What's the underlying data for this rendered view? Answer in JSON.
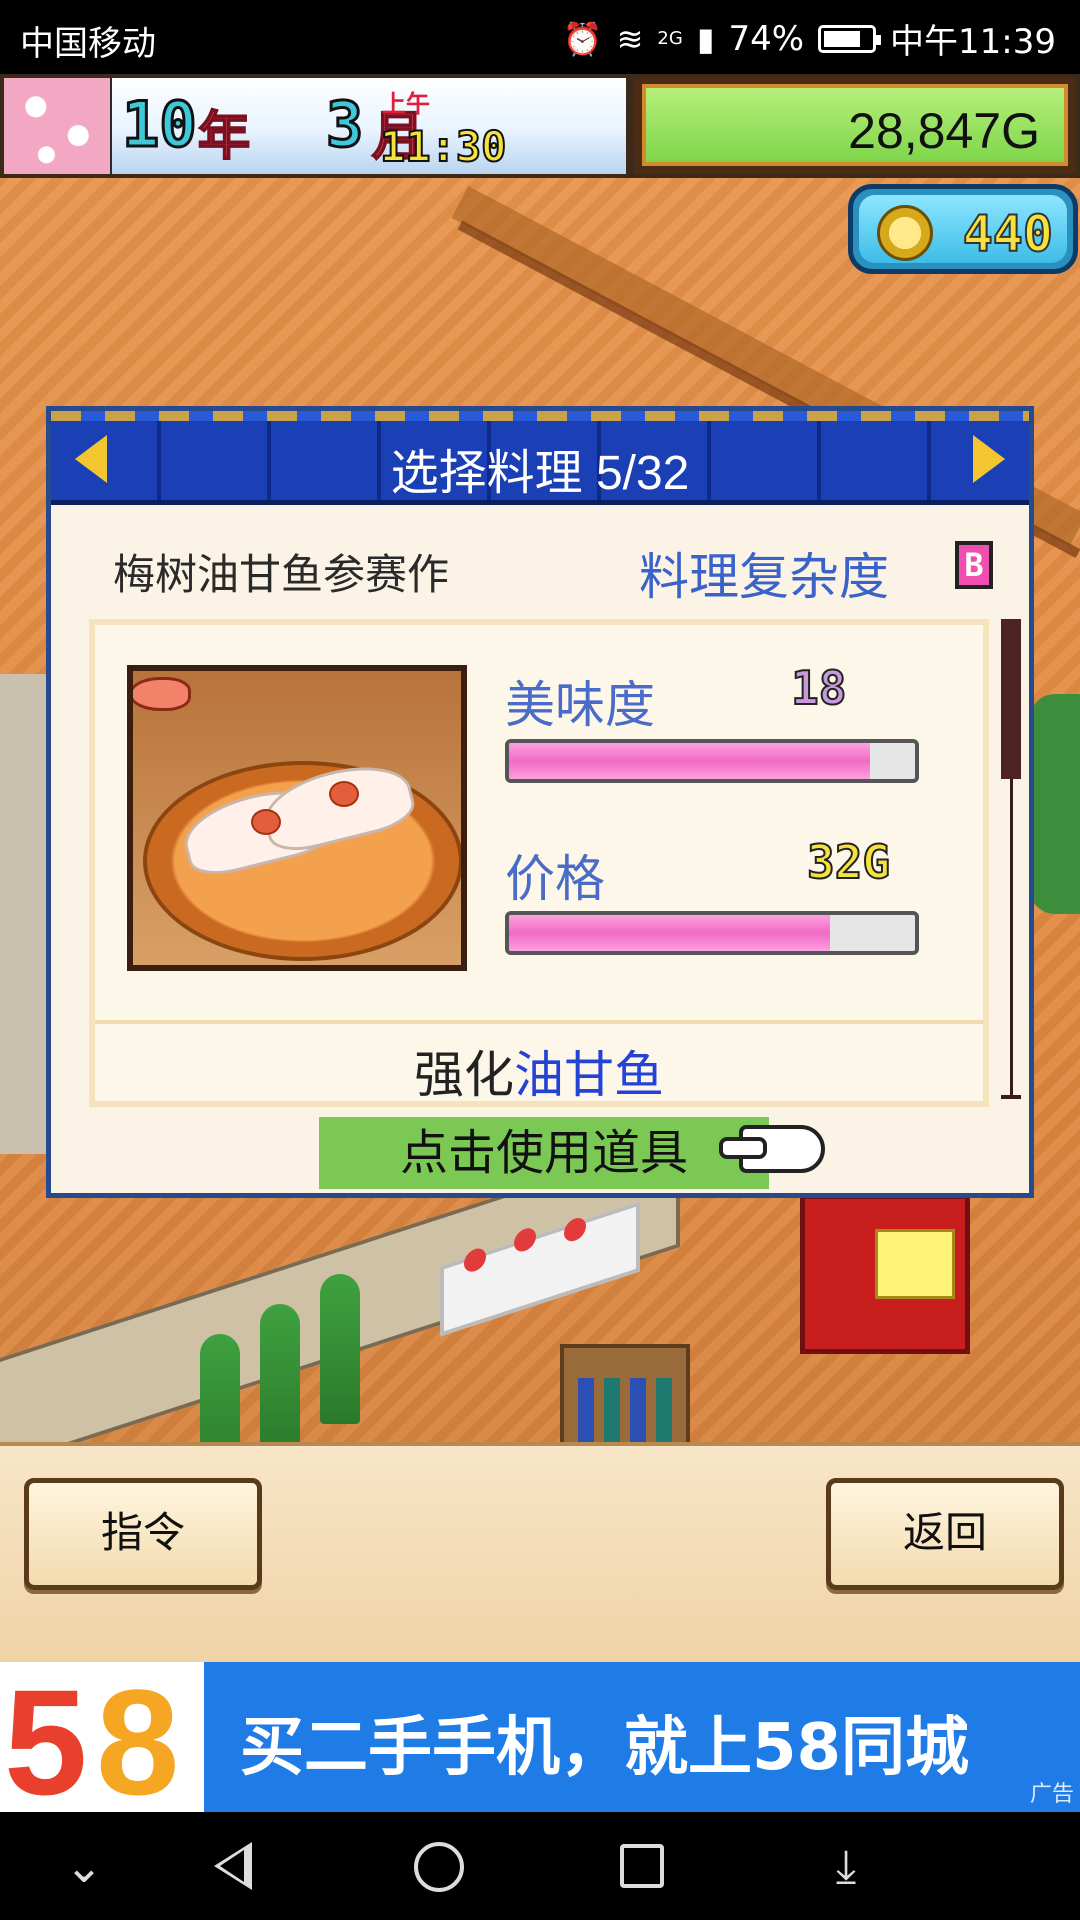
{
  "status_bar": {
    "carrier": "中国移动",
    "signal_label": "2G",
    "battery_pct": "74%",
    "clock": "中午11:39"
  },
  "hud": {
    "year": "10",
    "year_unit": "年",
    "month": "3",
    "month_unit": "月",
    "ampm": "上午",
    "time": "11:30",
    "money": "28,847G",
    "coins": "440"
  },
  "dialog": {
    "title": "选择料理 5/32",
    "dish_name": "梅树油甘鱼参赛作",
    "complexity_label": "料理复杂度",
    "complexity_grade": "B",
    "taste_label": "美味度",
    "taste_value": "18",
    "taste_fill": 0.89,
    "price_label": "价格",
    "price_value": "32G",
    "price_fill": 0.79,
    "effect_prefix": "强化",
    "effect_target": "油甘鱼",
    "use_button": "点击使用道具"
  },
  "commands": {
    "command_button": "指令",
    "back_button": "返回"
  },
  "ad": {
    "logo_5": "5",
    "logo_8": "8",
    "text": "买二手手机，就上58同城",
    "tag": "广告"
  },
  "colors": {
    "dialog_header": "#1b3fb4",
    "stat_label": "#4a6bc8",
    "bar_fill": "#f06bc6",
    "use_button": "#7cc855",
    "ad_bg": "#1f7be6"
  }
}
